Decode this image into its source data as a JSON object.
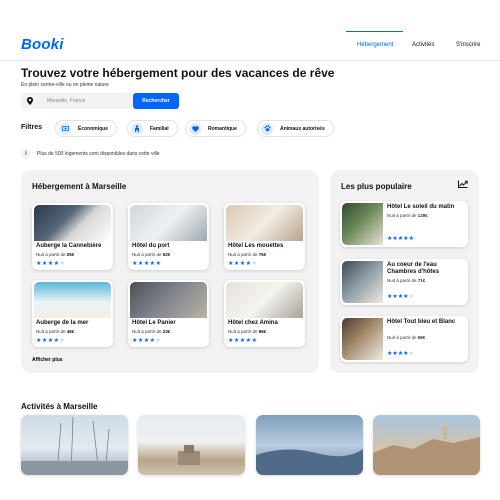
{
  "brand": {
    "logo": "Booki",
    "color": "#0065FC"
  },
  "nav": {
    "items": [
      "Hébergement",
      "Activités",
      "S'inscrire"
    ],
    "active": "Hébergement"
  },
  "hero": {
    "title": "Trouvez votre hébergement pour des vacances de rêve",
    "subtitle": "En plein centre-ville ou en pleine nature"
  },
  "search": {
    "icon": "location-pin-icon",
    "value": "Marseille, France",
    "button_label": "Rechercher"
  },
  "filters": {
    "label": "Filtres",
    "items": [
      {
        "label": "Économique",
        "icon": "money-icon"
      },
      {
        "label": "Familial",
        "icon": "child-icon"
      },
      {
        "label": "Romantique",
        "icon": "heart-icon"
      },
      {
        "label": "Animaux autorisés",
        "icon": "paw-icon"
      }
    ]
  },
  "info": {
    "icon": "info-icon",
    "text": "Plus de 500 logements sont disponibles dans cette ville"
  },
  "accommodations": {
    "title": "Hébergement à Marseille",
    "price_prefix": "Nuit à partir de",
    "show_more": "Afficher plus",
    "items": [
      {
        "name": "Auberge la Cannebière",
        "price": "25€",
        "rating": 4
      },
      {
        "name": "Hôtel du port",
        "price": "52€",
        "rating": 5
      },
      {
        "name": "Hôtel Les mouettes",
        "price": "76€",
        "rating": 4
      },
      {
        "name": "Auberge de la mer",
        "price": "46€",
        "rating": 4
      },
      {
        "name": "Hôtel Le Panier",
        "price": "23€",
        "rating": 4
      },
      {
        "name": "Hôtel chez Amina",
        "price": "96€",
        "rating": 5
      }
    ]
  },
  "popular": {
    "title": "Les plus populaire",
    "icon": "trending-icon",
    "price_prefix": "Nuit à partir de",
    "items": [
      {
        "name": "Hôtel Le soleil du matin",
        "price": "128€",
        "rating": 5
      },
      {
        "name": "Au coeur de l'eau Chambres d'hôtes",
        "price": "71€",
        "rating": 4
      },
      {
        "name": "Hôtel Tout bleu et Blanc",
        "price": "68€",
        "rating": 4
      }
    ]
  },
  "activities": {
    "title": "Activités à Marseille"
  },
  "colors": {
    "accent": "#0065FC",
    "panel": "#F2F2F2",
    "star_off": "#D6D6D6"
  }
}
